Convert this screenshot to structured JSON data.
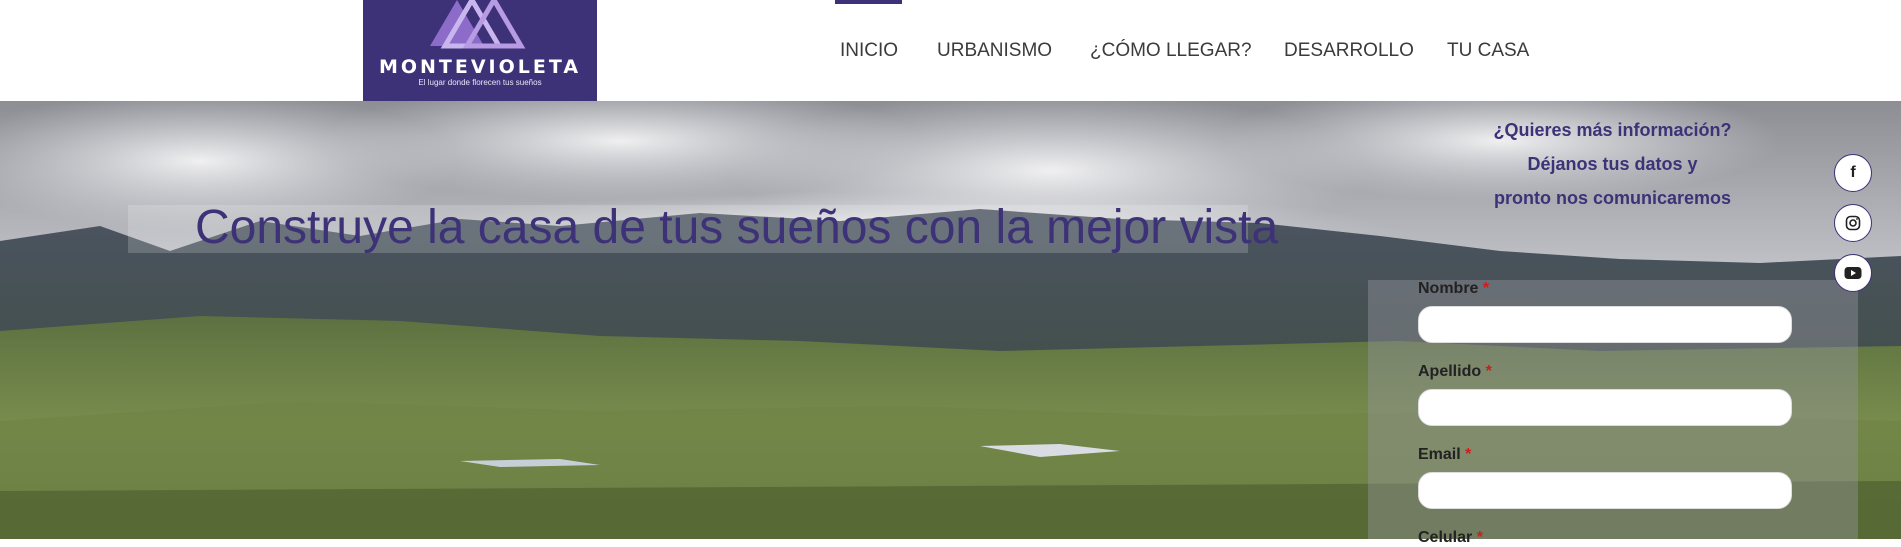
{
  "brand": {
    "name": "MONTEVIOLETA",
    "tagline": "El lugar donde florecen tus sueños",
    "color": "#3d3277"
  },
  "nav": {
    "items": [
      {
        "label": "INICIO",
        "active": true
      },
      {
        "label": "URBANISMO"
      },
      {
        "label": "¿CÓMO LLEGAR?"
      },
      {
        "label": "DESARROLLO"
      },
      {
        "label": "TU CASA"
      }
    ]
  },
  "hero": {
    "headline": "Construye la casa de tus sueños con la mejor vista",
    "info_lines": [
      "¿Quieres más información?",
      "Déjanos tus datos y",
      "pronto nos comunicaremos"
    ]
  },
  "form": {
    "fields": [
      {
        "label": "Nombre",
        "required": "*",
        "value": ""
      },
      {
        "label": "Apellido",
        "required": "*",
        "value": ""
      },
      {
        "label": "Email",
        "required": "*",
        "value": ""
      },
      {
        "label": "Celular",
        "required": "*",
        "value": ""
      }
    ]
  },
  "social": [
    {
      "icon": "facebook-icon",
      "glyph": "f"
    },
    {
      "icon": "instagram-icon",
      "glyph": ""
    },
    {
      "icon": "youtube-icon",
      "glyph": ""
    }
  ]
}
